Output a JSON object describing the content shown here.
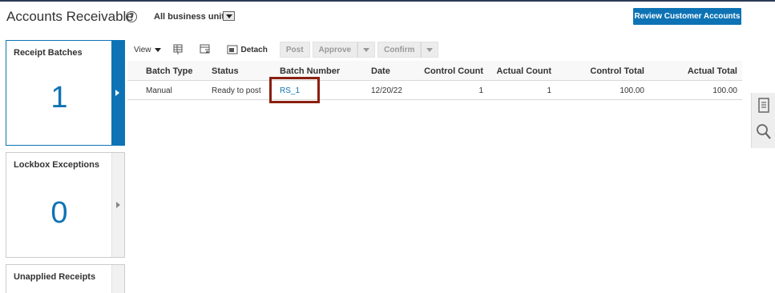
{
  "header": {
    "title": "Accounts Receivable",
    "help_glyph": "?",
    "business_units_label": "All business units",
    "review_button": "Review Customer Accounts"
  },
  "tiles": [
    {
      "title": "Receipt Batches",
      "count": "1",
      "active": true
    },
    {
      "title": "Lockbox Exceptions",
      "count": "0",
      "active": false
    },
    {
      "title": "Unapplied Receipts",
      "count": "",
      "active": false
    }
  ],
  "toolbar": {
    "view_label": "View",
    "detach_label": "Detach",
    "post_label": "Post",
    "approve_label": "Approve",
    "confirm_label": "Confirm"
  },
  "table": {
    "columns": [
      "Batch Type",
      "Status",
      "Batch Number",
      "Date",
      "Control Count",
      "Actual Count",
      "Control Total",
      "Actual Total"
    ],
    "rows": [
      [
        "Manual",
        "Ready to post",
        "RS_1",
        "12/20/22",
        "1",
        "1",
        "100.00",
        "100.00"
      ]
    ]
  },
  "side_panel": {
    "icons": [
      "document-icon",
      "search-icon"
    ]
  },
  "colors": {
    "accent": "#0d73b5",
    "highlight": "#8b1f10"
  }
}
